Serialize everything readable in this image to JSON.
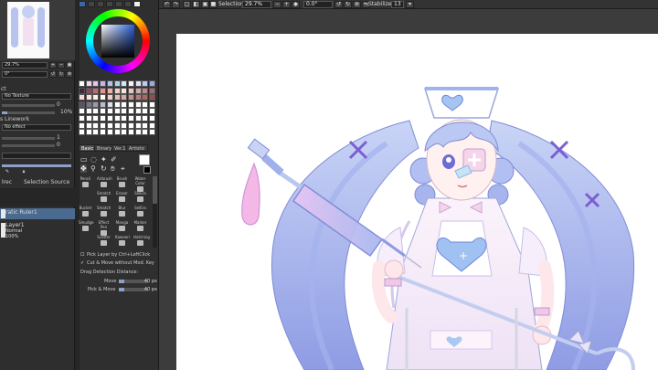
{
  "toolbar": {
    "selection_label": "Selection",
    "zoom_value": "29.7%",
    "angle_value": "0.0°",
    "stabilizer_label": "Stabilizer",
    "stabilizer_value": "13"
  },
  "navigator": {
    "zoom_value": "29.7%",
    "angle_value": "0°"
  },
  "layer_props": {
    "effect_label": "ct",
    "texture_value": "No Texture",
    "texture_amount": "0",
    "texture_percent": "10%",
    "linework_label": "s Linework",
    "linework_value": "No effect",
    "linework_amount_1": "1",
    "linework_amount_2": "0"
  },
  "layers": {
    "panel_label_1": "lrec",
    "panel_label_2": "Selection Source",
    "items": [
      {
        "name": "ratic Ruler1",
        "selected": true
      },
      {
        "name": "Layer1",
        "mode": "Normal",
        "opacity": "100%"
      }
    ]
  },
  "tabs": [
    "Basic",
    "Binary",
    "Ver.1",
    "Artistic"
  ],
  "tools": [
    "Pencil",
    "Airbrush",
    "Brush",
    "Water Color",
    "",
    "Smatch",
    "Eraser",
    "SelEra",
    "Bucket",
    "Smatch",
    "Blur",
    "SelEra",
    "Smudge",
    "Effect Pen",
    "Manga",
    "Marker",
    "",
    "Scatter",
    "Kawaeri",
    "Hatching"
  ],
  "move_options": {
    "pick_layer": "Pick Layer by Ctrl+LeftClick",
    "cut_move": "Cut & Move without Mod. Key",
    "drag_detection": "Drag Detection Distance:",
    "move_label": "Move",
    "move_value": "40 px",
    "pick_move_label": "Pick & Move",
    "pick_move_value": "40 px"
  },
  "colors": {
    "accent": "#8ea0c8",
    "hair": "#b7c6f2",
    "hair_shadow": "#8e9be0",
    "dress_pink": "#f4c8e6",
    "canvas_bg": "#ffffff"
  },
  "icons": {
    "undo": "undo-icon",
    "redo": "redo-icon",
    "zoom_in": "plus-icon",
    "zoom_out": "minus-icon",
    "rotate": "rotate-icon",
    "close": "close-icon"
  }
}
